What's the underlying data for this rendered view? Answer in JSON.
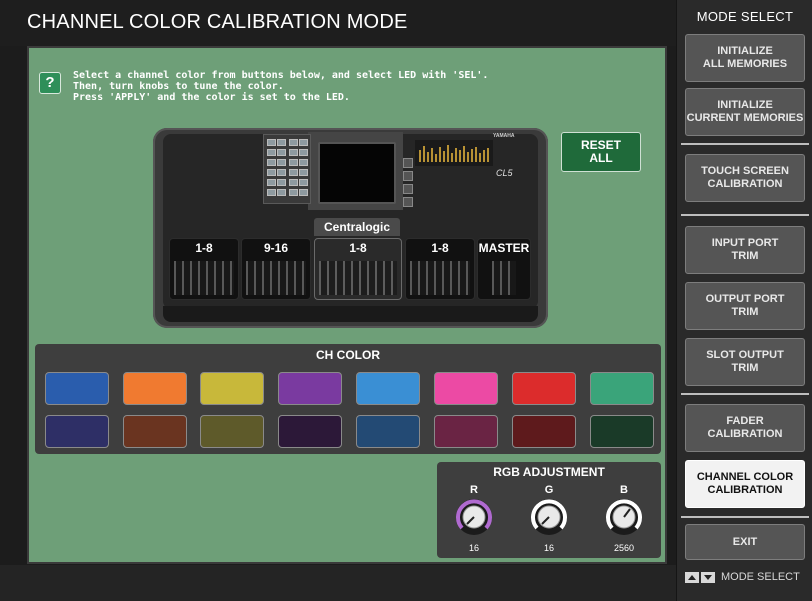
{
  "title": "CHANNEL COLOR CALIBRATION MODE",
  "help_icon": "?",
  "instructions": [
    "Select a channel color from buttons below, and select LED with 'SEL'.",
    "Then, turn knobs to tune the color.",
    "Press 'APPLY' and the color is set to the LED."
  ],
  "console": {
    "brand": "YAMAHA",
    "model": "CL5",
    "centralogic_label": "Centralogic",
    "banks": [
      "1-8",
      "9-16",
      "1-8",
      "1-8",
      "MASTER"
    ]
  },
  "reset_all_label": "RESET\nALL",
  "ch_color": {
    "title": "CH COLOR",
    "row1": [
      "#2a5dad",
      "#f07a30",
      "#c8b83a",
      "#7a3aa0",
      "#3a8fd4",
      "#ec4aa4",
      "#dc2c2c",
      "#3aa47a"
    ],
    "row2": [
      "#2e2f66",
      "#6a3420",
      "#5e5a2a",
      "#2c1838",
      "#234a74",
      "#6a2444",
      "#5e1a1c",
      "#1a3a28"
    ]
  },
  "rgb": {
    "title": "RGB ADJUSTMENT",
    "knobs": [
      {
        "letter": "R",
        "value": "16",
        "ring": "#b06ad0"
      },
      {
        "letter": "G",
        "value": "16",
        "ring": "#ffffff"
      },
      {
        "letter": "B",
        "value": "2560",
        "ring": "#ffffff"
      }
    ]
  },
  "sidebar": {
    "title": "MODE SELECT",
    "buttons": [
      "INITIALIZE\nALL MEMORIES",
      "INITIALIZE\nCURRENT MEMORIES",
      "TOUCH SCREEN\nCALIBRATION",
      "INPUT PORT\nTRIM",
      "OUTPUT PORT\nTRIM",
      "SLOT OUTPUT\nTRIM",
      "FADER\nCALIBRATION",
      "CHANNEL COLOR\nCALIBRATION",
      "EXIT"
    ],
    "footer": "MODE SELECT"
  }
}
